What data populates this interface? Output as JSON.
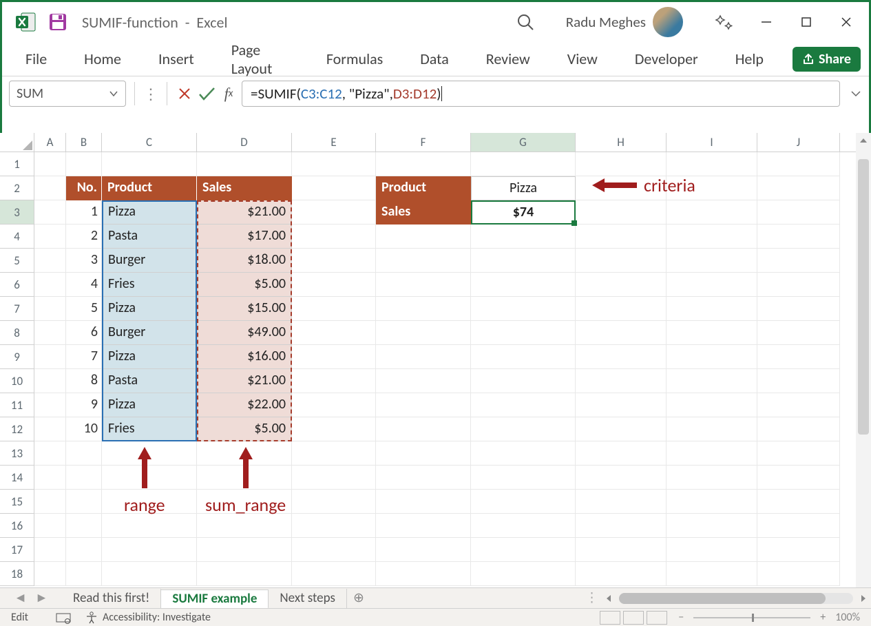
{
  "title_bar": {
    "doc_name": "SUMIF-function",
    "app_name": "Excel",
    "user_name": "Radu Meghes"
  },
  "ribbon_tabs": [
    "File",
    "Home",
    "Insert",
    "Page Layout",
    "Formulas",
    "Data",
    "Review",
    "View",
    "Developer",
    "Help"
  ],
  "share_label": "Share",
  "name_box": "SUM",
  "formula": {
    "prefix": "=SUMIF(",
    "ref1": "C3:C12",
    "mid": ", \"Pizza\", ",
    "ref2": "D3:D12",
    "suffix": ")"
  },
  "columns": [
    "A",
    "B",
    "C",
    "D",
    "E",
    "F",
    "G",
    "H",
    "I",
    "J"
  ],
  "rows": [
    "1",
    "2",
    "3",
    "4",
    "5",
    "6",
    "7",
    "8",
    "9",
    "10",
    "11",
    "12",
    "13",
    "14",
    "15",
    "16",
    "17",
    "18"
  ],
  "table1": {
    "headers": {
      "no": "No.",
      "product": "Product",
      "sales": "Sales"
    },
    "rows": [
      {
        "no": "1",
        "product": "Pizza",
        "sales": "$21.00"
      },
      {
        "no": "2",
        "product": "Pasta",
        "sales": "$17.00"
      },
      {
        "no": "3",
        "product": "Burger",
        "sales": "$18.00"
      },
      {
        "no": "4",
        "product": "Fries",
        "sales": "$5.00"
      },
      {
        "no": "5",
        "product": "Pizza",
        "sales": "$15.00"
      },
      {
        "no": "6",
        "product": "Burger",
        "sales": "$49.00"
      },
      {
        "no": "7",
        "product": "Pizza",
        "sales": "$16.00"
      },
      {
        "no": "8",
        "product": "Pasta",
        "sales": "$21.00"
      },
      {
        "no": "9",
        "product": "Pizza",
        "sales": "$22.00"
      },
      {
        "no": "10",
        "product": "Fries",
        "sales": "$5.00"
      }
    ]
  },
  "table2": {
    "product_label": "Product",
    "product_value": "Pizza",
    "sales_label": "Sales",
    "sales_value": "$74"
  },
  "annotations": {
    "criteria": "criteria",
    "range": "range",
    "sum_range": "sum_range"
  },
  "sheet_tabs": [
    "Read this first!",
    "SUMIF example",
    "Next steps"
  ],
  "status_bar": {
    "mode": "Edit",
    "accessibility": "Accessibility: Investigate",
    "zoom": "100%"
  }
}
